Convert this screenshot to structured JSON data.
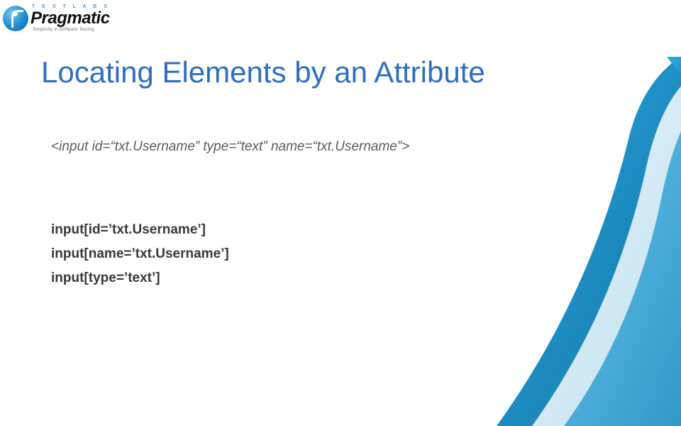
{
  "logo": {
    "labs": "T E S T   L A B S",
    "brand": "Pragmatic",
    "tagline": "Simplicity in Software Testing"
  },
  "title": "Locating Elements by an Attribute",
  "html_example": "<input id=“txt.Username” type=“text” name=“txt.Username”>",
  "selectors": [
    "input[id=’txt.Username’]",
    "input[name=’txt.Username’]",
    "input[type=’text’]"
  ]
}
